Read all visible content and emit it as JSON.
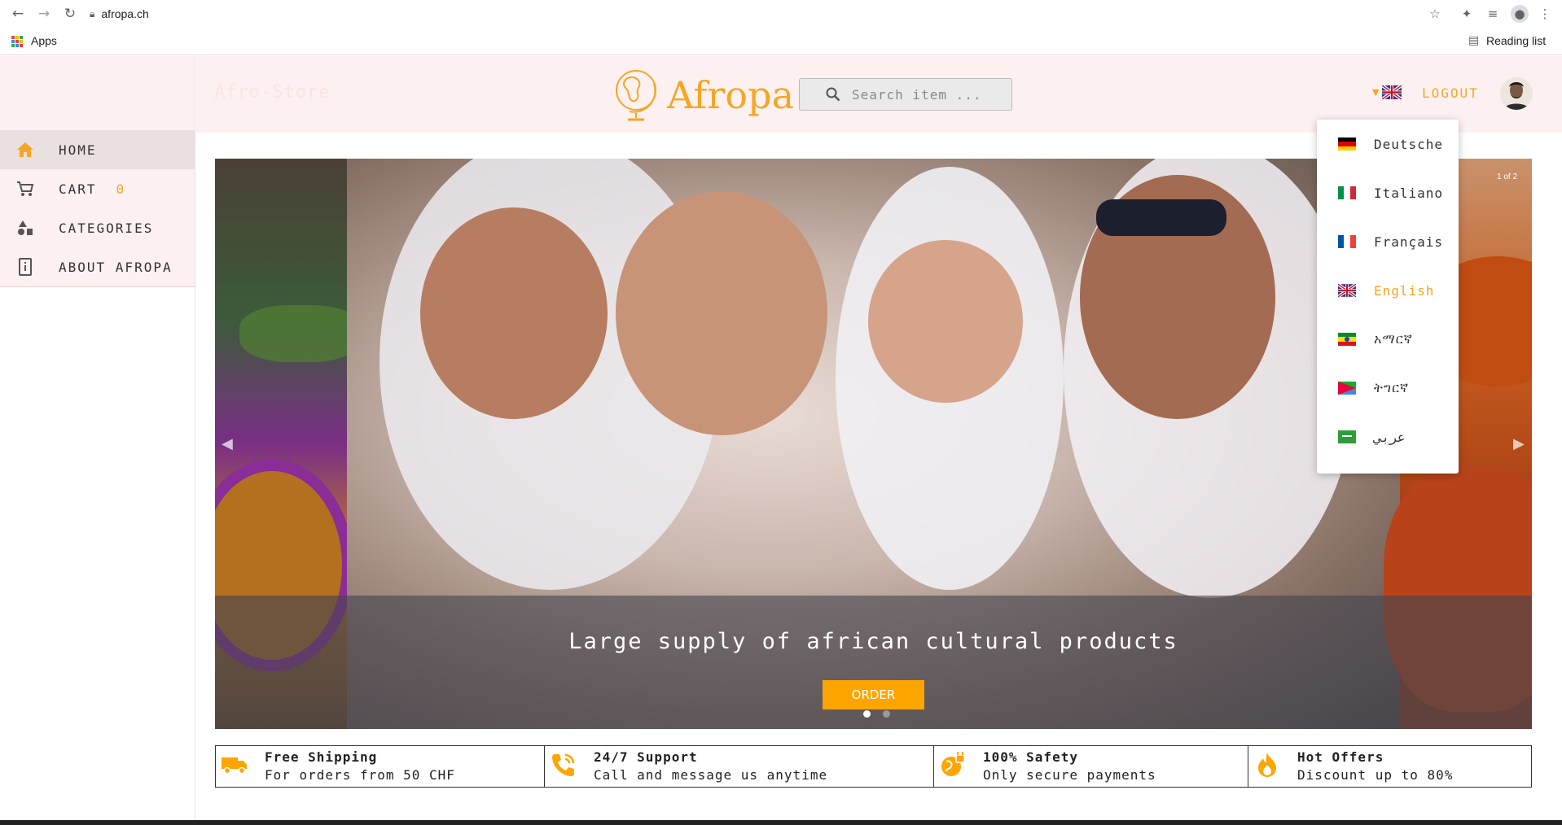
{
  "browser": {
    "url": "afropa.ch",
    "bookmarks_apps": "Apps",
    "reading_list": "Reading list"
  },
  "sidebar": {
    "items": [
      {
        "label": "HOME",
        "icon": "home-icon",
        "active": true
      },
      {
        "label": "CART",
        "icon": "cart-icon",
        "count": "0"
      },
      {
        "label": "CATEGORIES",
        "icon": "shapes-icon"
      },
      {
        "label": "ABOUT AFROPA",
        "icon": "info-icon"
      }
    ]
  },
  "header": {
    "brand_ghost": "Afro-Store",
    "logo_text": "Afropa",
    "search_placeholder": "Search item ...",
    "logout_label": "LOGOUT"
  },
  "language_menu": {
    "items": [
      {
        "label": "Deutsche",
        "flag": "de"
      },
      {
        "label": "Italiano",
        "flag": "it"
      },
      {
        "label": "Français",
        "flag": "fr"
      },
      {
        "label": "English",
        "flag": "gb",
        "selected": true
      },
      {
        "label": "አማርኛ",
        "flag": "et"
      },
      {
        "label": "ትግርኛ",
        "flag": "er"
      },
      {
        "label": "عربي",
        "flag": "sa"
      }
    ]
  },
  "carousel": {
    "caption": "Large supply of african cultural products",
    "button_label": "ORDER",
    "counter": "1 of 2",
    "active_slide": 1,
    "total_slides": 2
  },
  "features": [
    {
      "title": "Free Shipping",
      "subtitle": "For orders from 50 CHF",
      "icon": "truck-icon"
    },
    {
      "title": "24/7 Support",
      "subtitle": "Call and message us anytime",
      "icon": "phone-icon"
    },
    {
      "title": "100% Safety",
      "subtitle": "Only secure payments",
      "icon": "secure-globe-icon"
    },
    {
      "title": "Hot Offers",
      "subtitle": "Discount up to 80%",
      "icon": "flame-icon"
    }
  ],
  "colors": {
    "accent": "#f5a623",
    "header_bg": "#fdf0f0"
  }
}
